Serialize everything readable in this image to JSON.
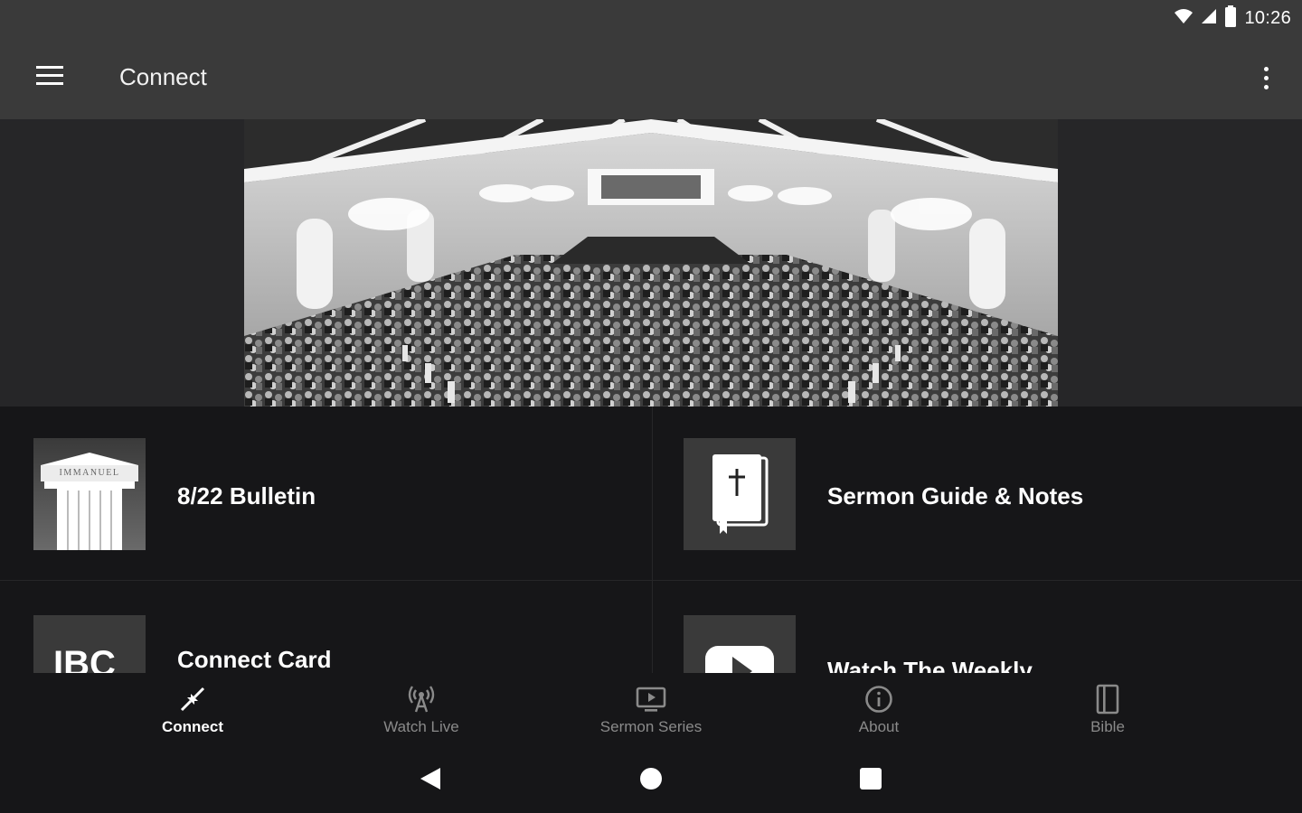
{
  "status_bar": {
    "time": "10:26",
    "icons": [
      "wifi-icon",
      "cell-signal-icon",
      "battery-icon"
    ]
  },
  "app_bar": {
    "title": "Connect",
    "menu_icon": "hamburger-menu-icon",
    "overflow_icon": "more-vert-icon"
  },
  "hero": {
    "image": "church-sanctuary-photo"
  },
  "tiles": [
    {
      "label": "8/22 Bulletin",
      "icon": "immanuel-column-logo",
      "logo_text": "IMMANUEL"
    },
    {
      "label": "Sermon Guide & Notes",
      "icon": "bible-cross-icon"
    },
    {
      "label": "Connect Card",
      "icon": "ibc-logo",
      "logo_text": "IBC"
    },
    {
      "label": "Watch The Weekly",
      "icon": "play-video-icon"
    }
  ],
  "bottom_nav": {
    "active_index": 0,
    "items": [
      {
        "label": "Connect",
        "icon": "connect-icon"
      },
      {
        "label": "Watch Live",
        "icon": "broadcast-icon"
      },
      {
        "label": "Sermon Series",
        "icon": "tv-play-icon"
      },
      {
        "label": "About",
        "icon": "info-icon"
      },
      {
        "label": "Bible",
        "icon": "book-icon"
      }
    ]
  },
  "system_nav": {
    "items": [
      "back-icon",
      "home-icon",
      "recents-icon"
    ]
  },
  "colors": {
    "app_bar": "#3a3a3a",
    "background": "#161618",
    "hero_band": "#262628",
    "text_primary": "#ffffff",
    "text_inactive": "#8a8a8a"
  }
}
